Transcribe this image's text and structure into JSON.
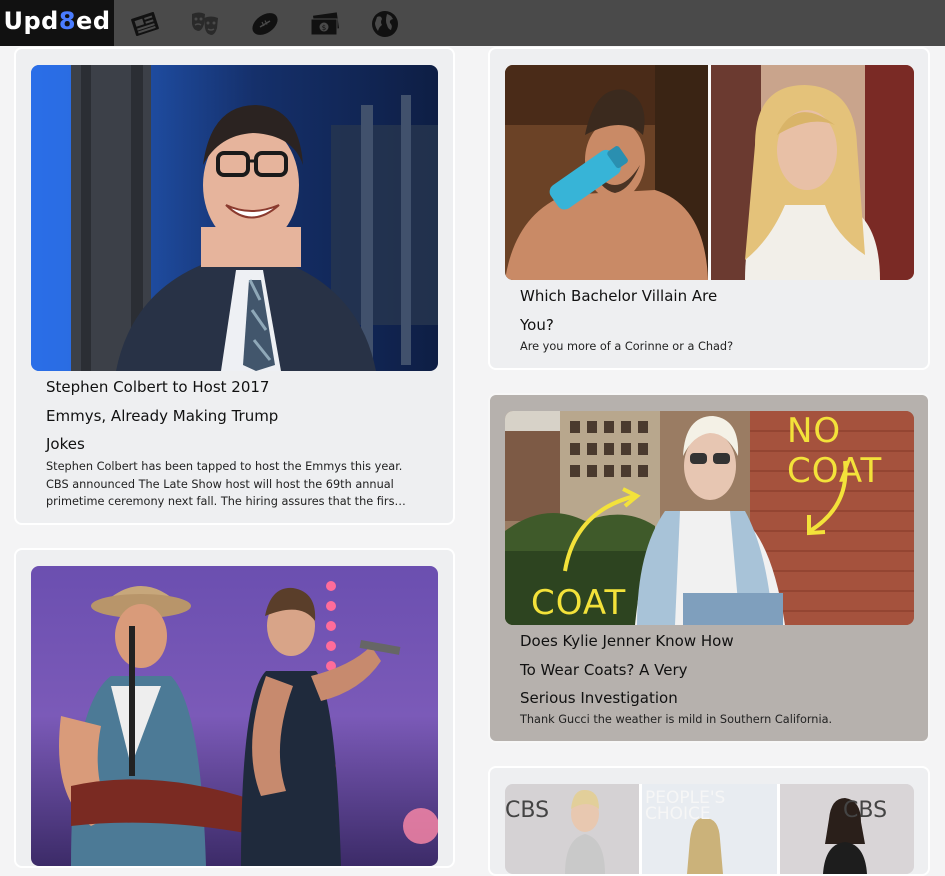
{
  "brand": {
    "logo_prefix": "Upd",
    "logo_eight": "8",
    "logo_suffix": "ed"
  },
  "nav": {
    "icons": [
      "newspaper-icon",
      "theater-masks-icon",
      "football-icon",
      "money-icon",
      "globe-icon"
    ]
  },
  "colors": {
    "topbar": "#4a4a4a",
    "logo_bg": "#111111",
    "logo_accent": "#4a7cff",
    "card": "#eeeff1",
    "card_highlight": "#b6b1ad",
    "photo_text": "#f3e23a"
  },
  "articles": [
    {
      "title": "Stephen Colbert to Host 2017 Emmys, Already Making Trump Jokes",
      "description": "Stephen Colbert has been tapped to host the Emmys this year. CBS announced The Late Show host will host the 69th annual primetime ceremony next fall. The hiring assures that the first Emmys of Donald Trump's presidency will have plenty of jokes about him."
    },
    {
      "title": "Which Bachelor Villain Are You?",
      "description": "Are you more of a Corinne or a Chad?"
    },
    {
      "title": "Does Kylie Jenner Know How To Wear Coats? A Very Serious Investigation",
      "description": "Thank Gucci the weather is mild in Southern California.",
      "photo_labels": {
        "right": "NO COAT",
        "left": "COAT"
      }
    },
    {
      "title": "",
      "description": ""
    },
    {
      "title": "",
      "description": "",
      "photo_text": {
        "left": "CBS",
        "center": "PEOPLE'S CHOICE",
        "right": "CBS"
      }
    }
  ]
}
